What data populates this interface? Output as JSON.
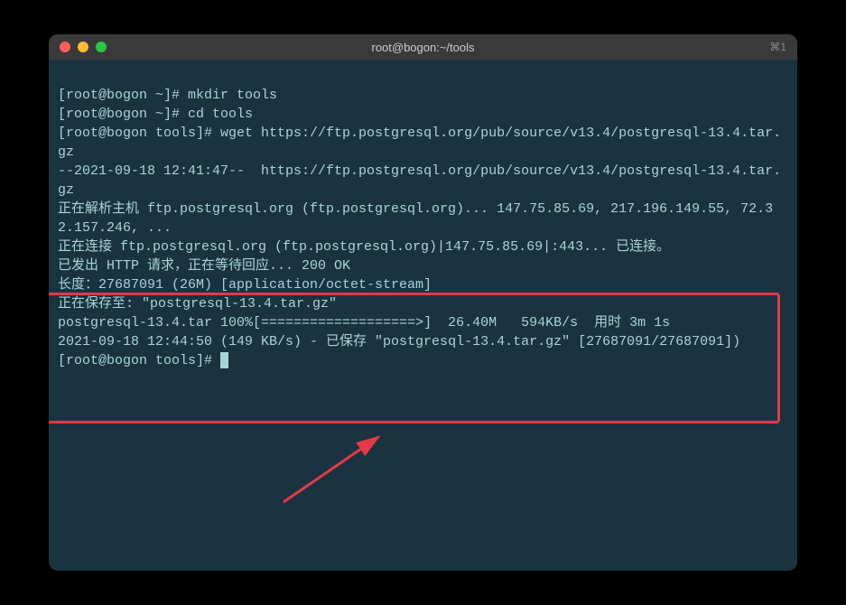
{
  "window": {
    "title": "root@bogon:~/tools",
    "shortcut": "⌘1"
  },
  "terminal": {
    "lines": {
      "l1_prompt": "[root@bogon ~]# ",
      "l1_cmd": "mkdir tools",
      "l2_prompt": "[root@bogon ~]# ",
      "l2_cmd": "cd tools",
      "l3_prompt": "[root@bogon tools]# ",
      "l3_cmd": "wget https://ftp.postgresql.org/pub/source/v13.4/postgresql-13.4.tar.gz",
      "l4": "--2021-09-18 12:41:47--  https://ftp.postgresql.org/pub/source/v13.4/postgresql-13.4.tar.gz",
      "l5": "正在解析主机 ftp.postgresql.org (ftp.postgresql.org)... 147.75.85.69, 217.196.149.55, 72.32.157.246, ...",
      "l6": "正在连接 ftp.postgresql.org (ftp.postgresql.org)|147.75.85.69|:443... 已连接。",
      "l7": "已发出 HTTP 请求，正在等待回应... 200 OK",
      "l8": "长度：27687091 (26M) [application/octet-stream]",
      "l9": "正在保存至: \"postgresql-13.4.tar.gz\"",
      "l10": "",
      "l11": "postgresql-13.4.tar 100%[===================>]  26.40M   594KB/s  用时 3m 1s",
      "l12": "",
      "l13": "2021-09-18 12:44:50 (149 KB/s) - 已保存 \"postgresql-13.4.tar.gz\" [27687091/27687091])",
      "l14": "",
      "l15_prompt": "[root@bogon tools]# "
    }
  }
}
